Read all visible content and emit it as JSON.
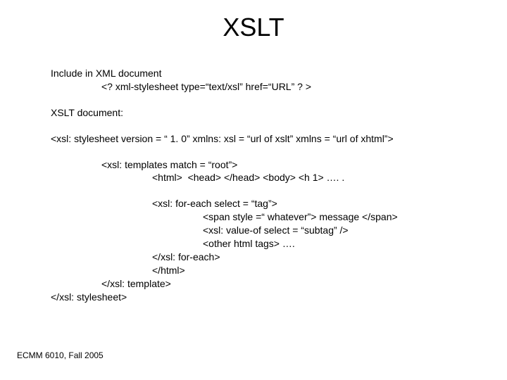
{
  "title": "XSLT",
  "lines": {
    "l0": "Include in XML document",
    "l1": "<? xml-stylesheet type=“text/xsl” href=“URL” ? >",
    "l2": "XSLT document:",
    "l3": "<xsl: stylesheet version = “ 1. 0” xmlns: xsl = “url of xslt” xmlns = “url of xhtml”>",
    "l4": "<xsl: templates match = “root”>",
    "l5": "<html>  <head> </head> <body> <h 1> …. .",
    "l6": "<xsl: for-each select = “tag”>",
    "l7": "<span style =“ whatever”> message </span>",
    "l8": "<xsl: value-of select = “subtag” />",
    "l9": "<other html tags> ….",
    "l10": "</xsl: for-each>",
    "l11": "</html>",
    "l12": "</xsl: template>",
    "l13": "</xsl: stylesheet>"
  },
  "footer": "ECMM 6010, Fall 2005"
}
